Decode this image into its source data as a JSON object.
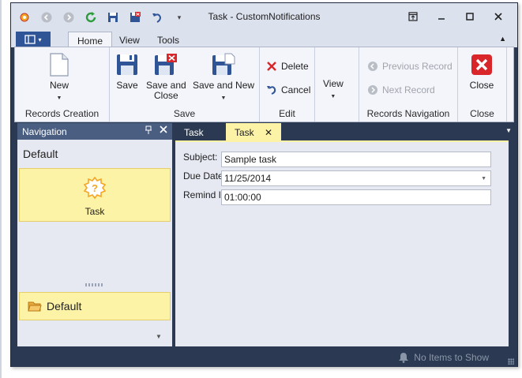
{
  "window": {
    "title": "Task - CustomNotifications"
  },
  "ribbon": {
    "tabs": [
      "Home",
      "View",
      "Tools"
    ],
    "groups": {
      "records_creation": {
        "label": "Records Creation",
        "new_label": "New"
      },
      "save": {
        "label": "Save",
        "save_label": "Save",
        "save_and_close_label": "Save and\nClose",
        "save_and_new_label": "Save and New"
      },
      "edit": {
        "label": "Edit",
        "delete_label": "Delete",
        "cancel_label": "Cancel"
      },
      "view": {
        "view_label": "View"
      },
      "records_navigation": {
        "label": "Records Navigation",
        "previous_label": "Previous Record",
        "next_label": "Next Record"
      },
      "close": {
        "label": "Close",
        "close_label": "Close"
      }
    }
  },
  "navigation": {
    "header": "Navigation",
    "group_title": "Default",
    "item_label": "Task",
    "group_button_label": "Default"
  },
  "document": {
    "tabs": [
      "Task",
      "Task"
    ],
    "fields": {
      "subject_label": "Subject:",
      "subject_value": "Sample task",
      "due_date_label": "Due Date:",
      "due_date_value": "11/25/2014",
      "remind_in_label": "Remind In:",
      "remind_in_value": "01:00:00"
    }
  },
  "status": {
    "text": "No Items to Show"
  },
  "colors": {
    "accent_yellow": "#fdf3a7",
    "chrome_dark": "#2b3a52",
    "nav_header": "#4a5e82"
  }
}
